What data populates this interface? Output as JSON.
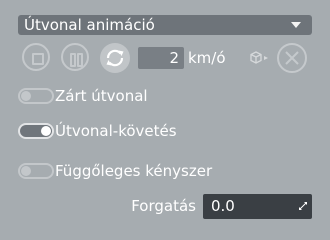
{
  "dropdown": {
    "selected": "Útvonal animáció"
  },
  "controls": {
    "speed_value": "2",
    "speed_unit": "km/ó"
  },
  "toggles": [
    {
      "label": "Zárt útvonal",
      "on": false
    },
    {
      "label": "Útvonal-követés",
      "on": true
    },
    {
      "label": "Függőleges kényszer",
      "on": false
    }
  ],
  "rotation": {
    "label": "Forgatás",
    "value": "0.0"
  },
  "icons": {
    "stop": "stop-icon",
    "pause": "pause-icon",
    "repeat": "repeat-icon",
    "cube": "cube-icon",
    "close": "close-icon",
    "dropdown_arrow": "chevron-down-icon",
    "resize": "resize-icon"
  },
  "colors": {
    "panel_bg": "#a6acb0",
    "control_bg": "#6e747a",
    "field_dark": "#3a3f44",
    "text": "#ffffff"
  }
}
